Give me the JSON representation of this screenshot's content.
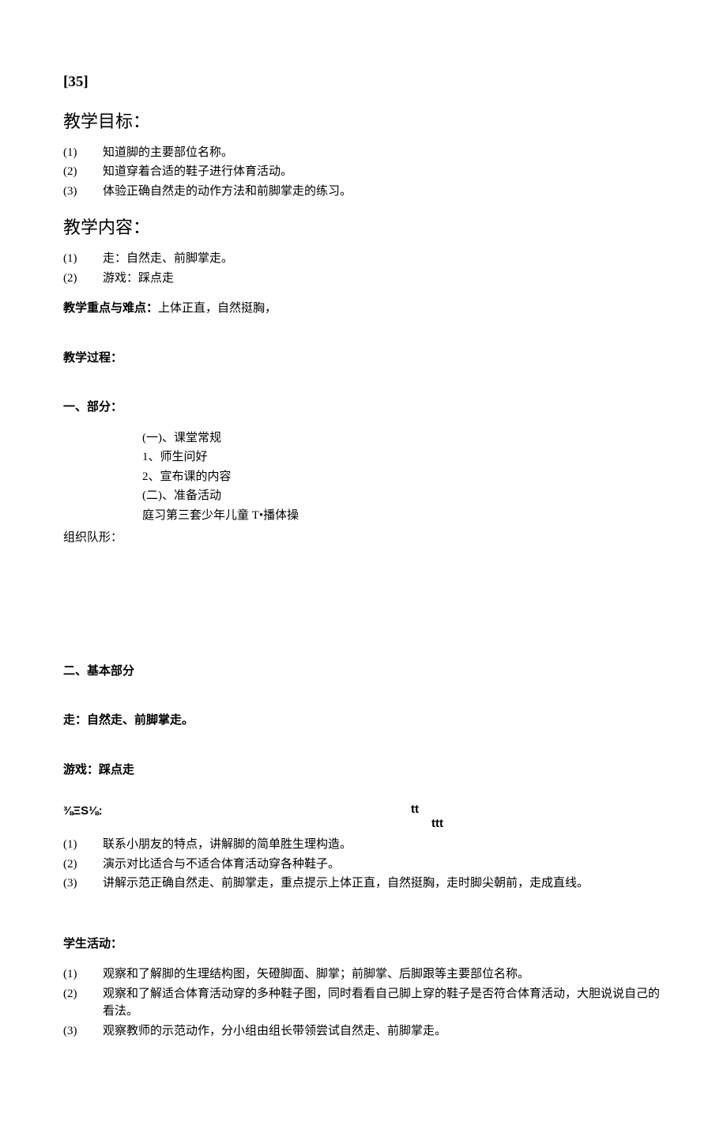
{
  "docNumber": "[35]",
  "sections": {
    "goals": {
      "heading": "教学目标：",
      "items": [
        {
          "num": "(1)",
          "text": "知道脚的主要部位名称。"
        },
        {
          "num": "(2)",
          "text": "知道穿着合适的鞋子进行体育活动。"
        },
        {
          "num": "(3)",
          "text": "体验正确自然走的动作方法和前脚掌走的练习。"
        }
      ]
    },
    "content": {
      "heading": "教学内容：",
      "items": [
        {
          "num": "(1)",
          "text": "走：自然走、前脚掌走。"
        },
        {
          "num": "(2)",
          "text": "游戏：踩点走"
        }
      ]
    },
    "keypoint": {
      "label": "教学重点与难点：",
      "text": "上体正直，自然挺胸，"
    },
    "process": {
      "heading": "教学过程："
    },
    "part1": {
      "heading": "一、部分：",
      "block": {
        "a_title": "(一)、课堂常规",
        "a1": "1、师生问好",
        "a2": "2、宣布课的内容",
        "b_title": "(二)、准备活动",
        "b1": "庭习第三套少年儿童 T•播体操"
      },
      "formation": "组织队形："
    },
    "part2": {
      "heading": "二、基本部分",
      "line1": "走：自然走、前脚掌走。",
      "line2": "游戏：踩点走"
    },
    "teacherAct": {
      "left": "⅜ΞS⅛:",
      "right1": "tt",
      "right2": "ttt",
      "items": [
        {
          "num": "(1)",
          "text": "联系小朋友的特点，讲解脚的简单胜生理构造。"
        },
        {
          "num": "(2)",
          "text": "演示对比适合与不适合体育活动穿各种鞋子。"
        },
        {
          "num": "(3)",
          "text": "讲解示范正确自然走、前脚掌走，重点提示上体正直，自然挺胸，走时脚尖朝前，走成直线。"
        }
      ]
    },
    "studentAct": {
      "heading": "学生活动：",
      "items": [
        {
          "num": "(1)",
          "text": "观察和了解脚的生理结构图，矢磴脚面、脚掌；前脚掌、后脚跟等主要部位名称。"
        },
        {
          "num": "(2)",
          "text": "观察和了解适合体育活动穿的多种鞋子图，同时看看自己脚上穿的鞋子是否符合体育活动，大胆说说自己的看法。"
        },
        {
          "num": "(3)",
          "text": "观察教师的示范动作，分小组由组长带领尝试自然走、前脚掌走。"
        }
      ]
    }
  }
}
